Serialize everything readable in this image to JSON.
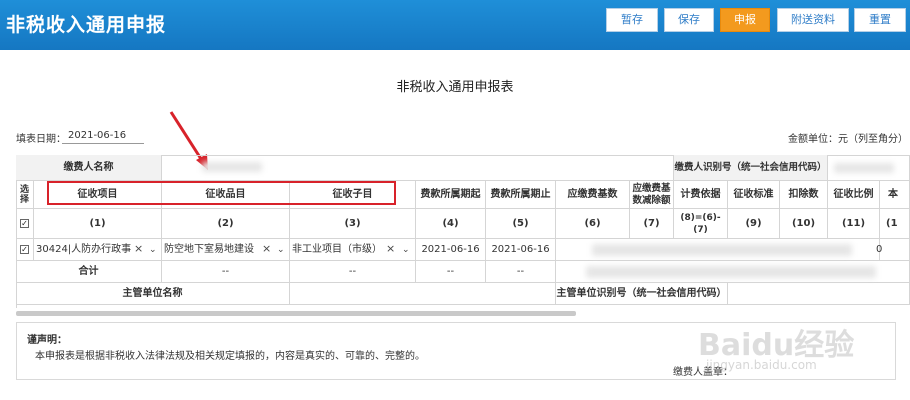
{
  "header": {
    "title": "非税收入通用申报",
    "buttons": {
      "stage": "暂存",
      "save": "保存",
      "declare": "申报",
      "attach": "附送资料",
      "reset": "重置"
    },
    "accent_color": "#1a82cc",
    "primary_button_color": "#f39a1e"
  },
  "form": {
    "title": "非税收入通用申报表",
    "fill_date_label": "填表日期：",
    "fill_date": "2021-06-16",
    "amount_unit": "金额单位：元（列至角分）"
  },
  "table": {
    "payer_name_label": "缴费人名称",
    "payer_id_label": "缴费人识别号（统一社会信用代码）",
    "select_label": "选择",
    "columns": [
      {
        "name": "征收项目",
        "num": "(1)"
      },
      {
        "name": "征收品目",
        "num": "(2)"
      },
      {
        "name": "征收子目",
        "num": "(3)"
      },
      {
        "name": "费款所属期起",
        "num": "(4)"
      },
      {
        "name": "费款所属期止",
        "num": "(5)"
      },
      {
        "name": "应缴费基数",
        "num": "(6)"
      },
      {
        "name": "应缴费基数减除额",
        "num": "(7)"
      },
      {
        "name": "计费依据",
        "num": "(8)=(6)-(7)"
      },
      {
        "name": "征收标准",
        "num": "(9)"
      },
      {
        "name": "扣除数",
        "num": "(10)"
      },
      {
        "name": "征收比例",
        "num": "(11)"
      },
      {
        "name": "本",
        "num": "(1"
      }
    ],
    "row": {
      "item": "30424|人防办行政事",
      "subitem": "防空地下室易地建设",
      "child": "非工业项目（市级）",
      "period_start": "2021-06-16",
      "period_end": "2021-06-16",
      "ratio_partial": "0"
    },
    "total_label": "合计",
    "dash": "--",
    "authority_name_label": "主管单位名称",
    "authority_id_label": "主管单位识别号（统一社会信用代码）"
  },
  "declaration": {
    "title": "谨声明：",
    "body": "本申报表是根据非税收入法律法规及相关规定填报的，内容是真实的、可靠的、完整的。",
    "signer_label": "缴费人盖章："
  },
  "watermark": {
    "brand": "Baidu经验",
    "url": "jingyan.baidu.com"
  }
}
